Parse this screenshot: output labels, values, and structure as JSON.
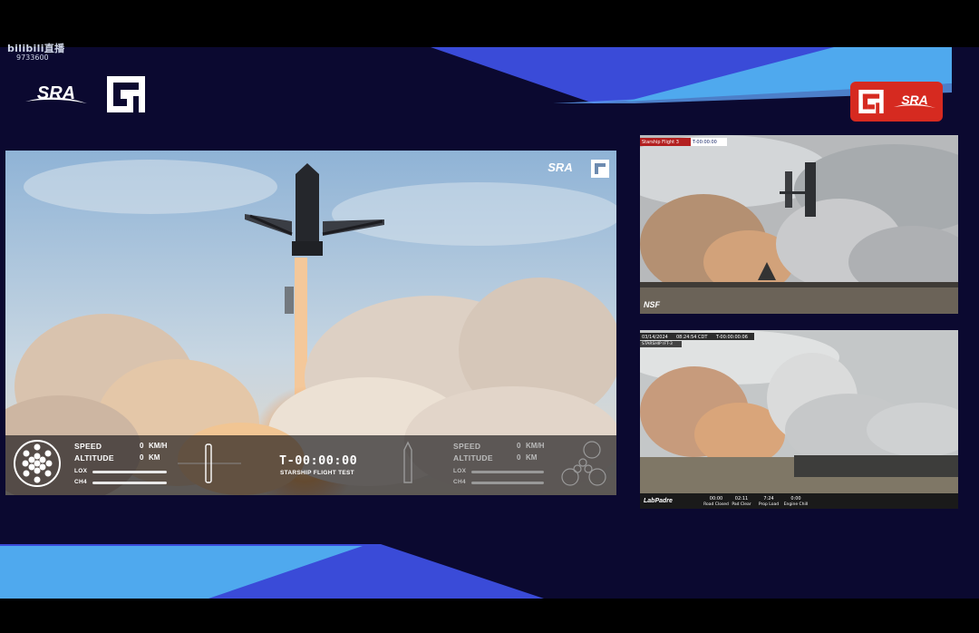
{
  "watermark": {
    "site": "bilibili直播",
    "room_id": "9733600"
  },
  "brand": {
    "sra": "SRA",
    "badge_text": "SRA",
    "accent": "#d62a20",
    "bg": "#0b0930",
    "stripe_light": "#4aa8ee",
    "stripe_dark": "#3548d8"
  },
  "main_feed": {
    "hud": {
      "left": {
        "speed_label": "SPEED",
        "speed_value": "0",
        "speed_unit": "KM/H",
        "altitude_label": "ALTITUDE",
        "altitude_value": "0",
        "altitude_unit": "KM",
        "lox_label": "LOX",
        "ch4_label": "CH4"
      },
      "timer": "T-00:00:00",
      "subtitle": "STARSHIP FLIGHT TEST",
      "right": {
        "speed_label": "SPEED",
        "speed_value": "0",
        "speed_unit": "KM/H",
        "altitude_label": "ALTITUDE",
        "altitude_value": "0",
        "altitude_unit": "KM",
        "lox_label": "LOX",
        "ch4_label": "CH4"
      }
    }
  },
  "side_feed_1": {
    "tag": "Starship Flight 3",
    "timer": "T-00:00:00",
    "brand": "NSF"
  },
  "side_feed_2": {
    "date": "03/14/2024",
    "time": "08:24:54 CDT",
    "timer": "T-00:00:00:06",
    "tag": "STARSHIP IFT-3",
    "brand": "LabPadre",
    "milestones": [
      {
        "time": "00:00",
        "label": "Road Closed"
      },
      {
        "time": "02:11",
        "label": "Pad Clear"
      },
      {
        "time": "7:24",
        "label": "Prop Load"
      },
      {
        "time": "0:00",
        "label": "Engine Chill"
      }
    ]
  }
}
